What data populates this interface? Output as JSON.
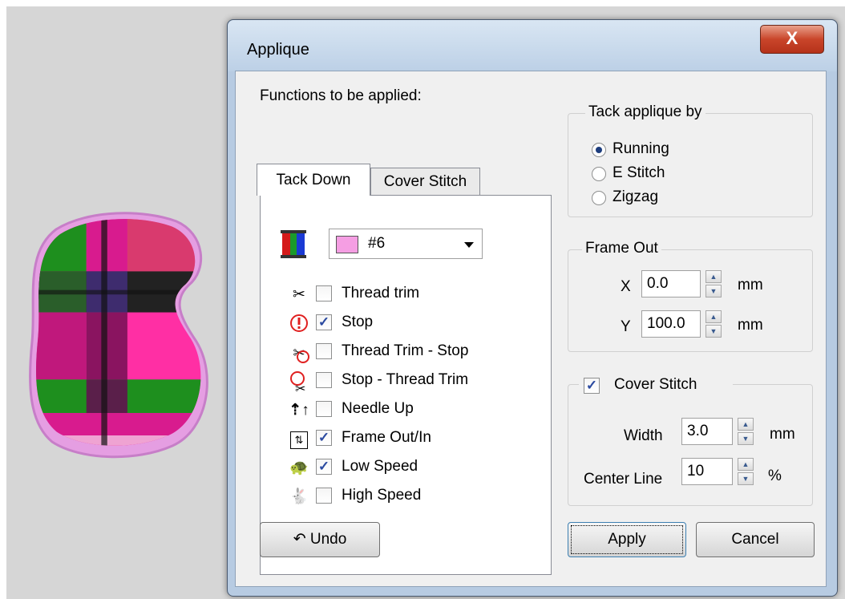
{
  "dialog": {
    "title": "Applique",
    "close_label": "X",
    "functions_label": "Functions to be applied:",
    "tabs": [
      {
        "label": "Tack Down",
        "active": true
      },
      {
        "label": "Cover Stitch",
        "active": false
      }
    ],
    "color": {
      "label": "#6",
      "swatch": "#f59ee3"
    },
    "functions": [
      {
        "label": "Thread trim",
        "checked": false,
        "icon": "scissors-icon"
      },
      {
        "label": "Stop",
        "checked": true,
        "icon": "stop-icon"
      },
      {
        "label": "Thread Trim - Stop",
        "checked": false,
        "icon": "trim-stop-icon"
      },
      {
        "label": "Stop - Thread Trim",
        "checked": false,
        "icon": "stop-trim-icon"
      },
      {
        "label": "Needle Up",
        "checked": false,
        "icon": "needle-up-icon"
      },
      {
        "label": "Frame Out/In",
        "checked": true,
        "icon": "frame-out-in-icon"
      },
      {
        "label": "Low Speed",
        "checked": true,
        "icon": "low-speed-icon"
      },
      {
        "label": "High Speed",
        "checked": false,
        "icon": "high-speed-icon"
      }
    ],
    "tack_applique": {
      "title": "Tack applique by",
      "options": [
        {
          "label": "Running",
          "selected": true
        },
        {
          "label": "E Stitch",
          "selected": false
        },
        {
          "label": "Zigzag",
          "selected": false
        }
      ]
    },
    "frame_out": {
      "title": "Frame Out",
      "x_label": "X",
      "x_value": "0.0",
      "x_unit": "mm",
      "y_label": "Y",
      "y_value": "100.0",
      "y_unit": "mm"
    },
    "cover_stitch": {
      "label": "Cover Stitch",
      "checked": true,
      "width_label": "Width",
      "width_value": "3.0",
      "width_unit": "mm",
      "center_label": "Center Line",
      "center_value": "10",
      "center_unit": "%"
    },
    "buttons": {
      "undo": "Undo",
      "apply": "Apply",
      "cancel": "Cancel"
    }
  }
}
